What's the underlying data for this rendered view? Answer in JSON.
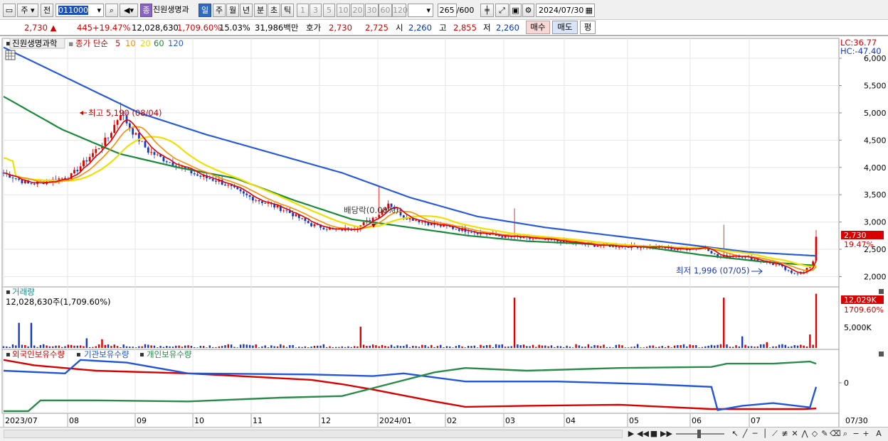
{
  "toolbar": {
    "market": "주",
    "prev_label": "전",
    "code": "011000",
    "name": "진원생명과",
    "period_tabs": [
      "일",
      "주",
      "월",
      "년",
      "분",
      "초",
      "틱"
    ],
    "intervals": [
      "1",
      "3",
      "5",
      "10",
      "20",
      "30",
      "60",
      "120"
    ],
    "count": "265",
    "count_max": "/600",
    "date": "2024/07/30"
  },
  "quote": {
    "price": "2,730",
    "change": "445",
    "change_pct": "+19.47%",
    "volume": "12,028,630",
    "volume_pct": "1,709.60%",
    "turnover": "15.03%",
    "amount": "31,986백만",
    "ask_label": "호가",
    "ask": "2,730",
    "bid": "2,725",
    "open_label": "시",
    "open": "2,260",
    "high_label": "고",
    "high": "2,855",
    "low_label": "저",
    "low": "2,260",
    "buy_label": "매수",
    "sell_label": "매도",
    "eval_label": "평"
  },
  "price_pane": {
    "stock_name": "진원생명과학",
    "legend_label": "종가 단순",
    "ma_periods": [
      "5",
      "10",
      "20",
      "60",
      "120"
    ],
    "ma_colors": [
      "#e00000",
      "#ff8a00",
      "#f0e000",
      "#1a8a3a",
      "#2a5bd7"
    ],
    "lc": "LC:36.77",
    "hc": "HC:-47.40",
    "y_ticks": [
      "6,000",
      "5,500",
      "5,000",
      "4,500",
      "4,000",
      "3,500",
      "3,000",
      "2,500",
      "2,000"
    ],
    "last_price": "2,730",
    "last_pct": "19.47%",
    "high_note": "최고 5,190 (08/04)",
    "low_note": "최저 1,996 (07/05)",
    "dividend_note": "배당락(0.00%)"
  },
  "volume_pane": {
    "title": "거래량",
    "value": "12,028,630주(1,709.60%)",
    "tick": "5,000K",
    "last_value": "12,029K",
    "last_pct": "1709.60%"
  },
  "holder_pane": {
    "titles": [
      "외국인보유수량",
      "기관보유수량",
      "개인보유수량"
    ],
    "colors": [
      "#d80000",
      "#2255d8",
      "#2a8a4a"
    ],
    "tick": "0"
  },
  "x_axis": {
    "labels": [
      "2023/07",
      "08",
      "09",
      "10",
      "11",
      "12",
      "2024/01",
      "02",
      "03",
      "04",
      "05",
      "06",
      "07"
    ],
    "last": "07/30"
  },
  "colors": {
    "up": "#e00000",
    "down": "#1838c8",
    "accent": "#2f6bc4"
  },
  "chart_data": {
    "type": "candlestick",
    "x_range": [
      "2023/07",
      "2024/07/30"
    ],
    "ylim": [
      1850,
      6300
    ],
    "high": {
      "value": 5190,
      "date": "08/04"
    },
    "low": {
      "value": 1996,
      "date": "07/05"
    },
    "last": {
      "value": 2730,
      "change_pct": 19.47
    },
    "ma5_samples": [
      3950,
      3700,
      4700,
      4200,
      3850,
      3400,
      2900,
      3050,
      3200,
      2800,
      2750,
      2650,
      2500,
      2750,
      2300,
      2400,
      2250,
      2100,
      2200,
      2730
    ],
    "ma60_samples": [
      5300,
      4700,
      4250,
      4000,
      3800,
      3400,
      3050,
      2900,
      2750,
      2650,
      2600,
      2550,
      2400,
      2280,
      2200
    ],
    "ma120_samples": [
      6200,
      5600,
      5000,
      4600,
      4250,
      3900,
      3450,
      3100,
      2900,
      2750,
      2600,
      2450,
      2380
    ]
  }
}
